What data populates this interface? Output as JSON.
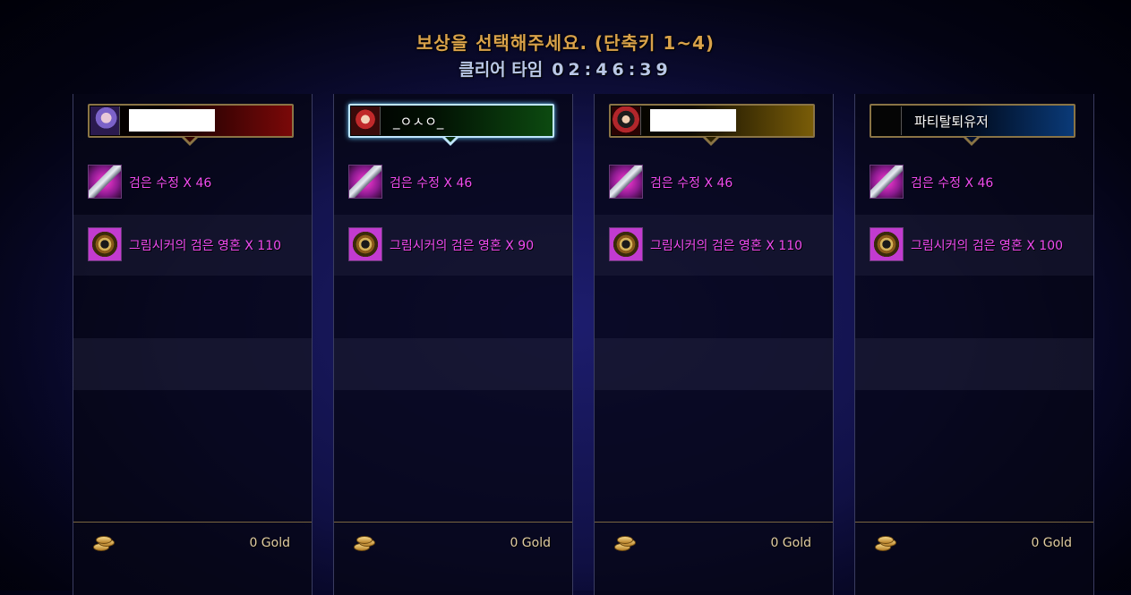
{
  "header": {
    "title": "보상을 선택해주세요. (단축키 1~4)",
    "timer_label": "클리어 타임",
    "timer_value": "02:46:39"
  },
  "players": [
    {
      "name": "",
      "items": [
        {
          "icon": "black-crystal-icon",
          "label": "검은 수정 X 46"
        },
        {
          "icon": "grim-seeker-soul-icon",
          "label": "그림시커의 검은 영혼 X 110"
        }
      ],
      "gold": "0 Gold"
    },
    {
      "name": "_ㅇㅅㅇ_",
      "items": [
        {
          "icon": "black-crystal-icon",
          "label": "검은 수정 X 46"
        },
        {
          "icon": "grim-seeker-soul-icon",
          "label": "그림시커의 검은 영혼 X 90"
        }
      ],
      "gold": "0 Gold"
    },
    {
      "name": "",
      "items": [
        {
          "icon": "black-crystal-icon",
          "label": "검은 수정 X 46"
        },
        {
          "icon": "grim-seeker-soul-icon",
          "label": "그림시커의 검은 영혼 X 110"
        }
      ],
      "gold": "0 Gold"
    },
    {
      "name": "파티탈퇴유저",
      "items": [
        {
          "icon": "black-crystal-icon",
          "label": "검은 수정 X 46"
        },
        {
          "icon": "grim-seeker-soul-icon",
          "label": "그림시커의 검은 영혼 X 100"
        }
      ],
      "gold": "0 Gold"
    }
  ],
  "colors": {
    "title": "#d9a24a",
    "timer": "#b9c7e6",
    "item_text": "#f04bf0",
    "gold_text": "#e0cca0",
    "selected_border": "#bfe6ff"
  }
}
